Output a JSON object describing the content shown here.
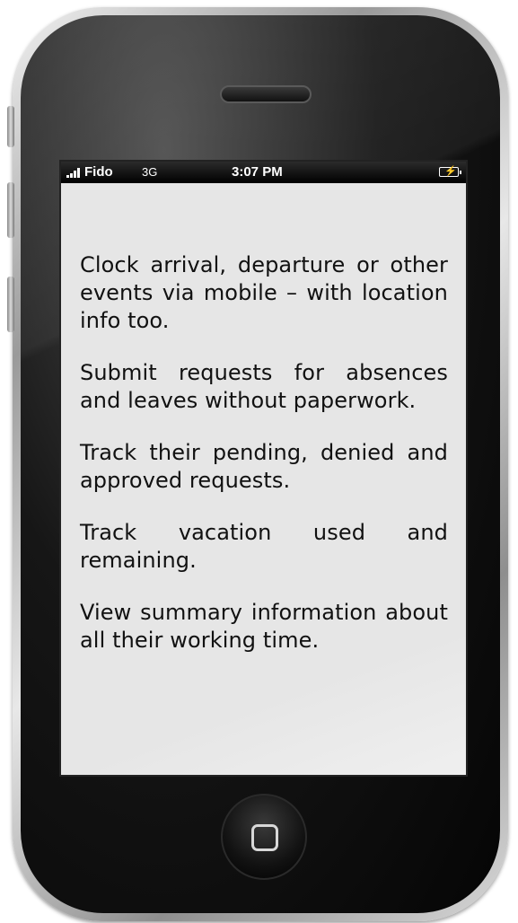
{
  "status_bar": {
    "carrier": "Fido",
    "network": "3G",
    "time": "3:07 PM"
  },
  "features": [
    "Clock arrival, departure or other events via mobile – with location info too.",
    "Submit requests for absences and leaves without paperwork.",
    "Track their pending, denied and approved requests.",
    "Track vacation used and remaining.",
    "View summary information about all their working time."
  ]
}
